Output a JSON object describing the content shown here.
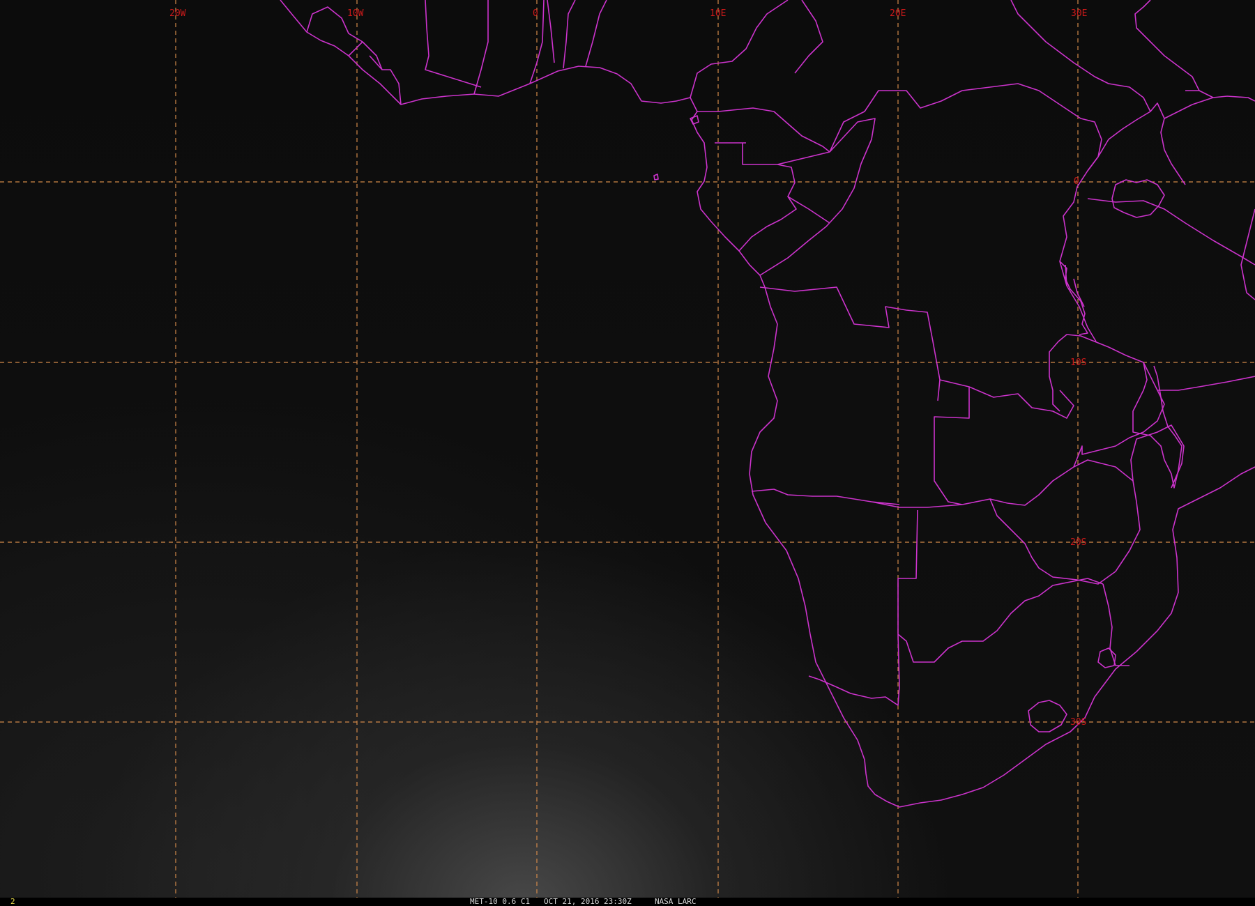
{
  "map": {
    "longitude_labels": [
      "20W",
      "10W",
      "0",
      "10E",
      "20E",
      "30E"
    ],
    "latitude_labels": [
      "0",
      "10S",
      "20S",
      "30S"
    ],
    "colors": {
      "boundaries": "#cc33cc",
      "graticule": "#d48a4a",
      "grid_labels": "#cc1a1a",
      "background": "#000000"
    }
  },
  "status": {
    "frame_number": "2",
    "satellite_band": "MET-10 0.6 C1",
    "datetime": "OCT 21, 2016 23:30Z",
    "source": "NASA LARC"
  }
}
